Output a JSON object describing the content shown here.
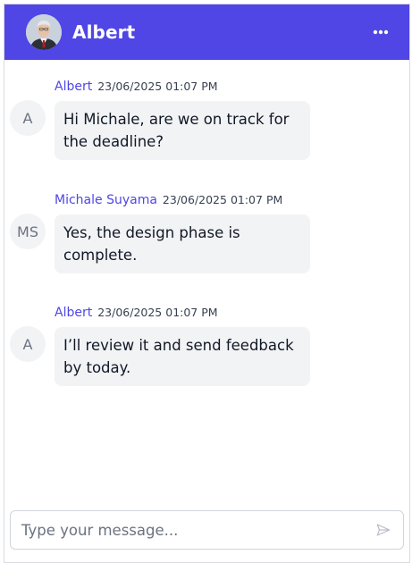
{
  "colors": {
    "accent": "#4f46e5",
    "bubble_bg": "#f2f3f5",
    "header_text": "#ffffff"
  },
  "header": {
    "title": "Albert",
    "avatar_icon": "user-photo",
    "menu_icon": "ellipsis-icon"
  },
  "messages": [
    {
      "author": "Albert",
      "timestamp": "23/06/2025 01:07 PM",
      "initials": "A",
      "text": "Hi Michale, are we on track for the deadline?"
    },
    {
      "author": "Michale Suyama",
      "timestamp": "23/06/2025 01:07 PM",
      "initials": "MS",
      "text": "Yes, the design phase is complete."
    },
    {
      "author": "Albert",
      "timestamp": "23/06/2025 01:07 PM",
      "initials": "A",
      "text": "I’ll review it and send feedback by today."
    }
  ],
  "composer": {
    "placeholder": "Type your message...",
    "value": "",
    "send_icon": "send-icon"
  }
}
